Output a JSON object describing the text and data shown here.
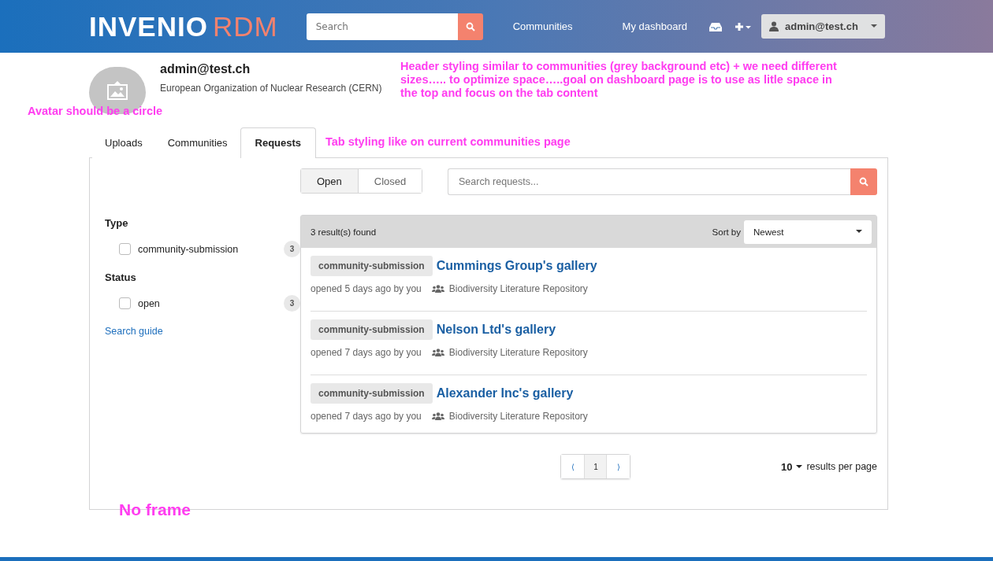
{
  "header": {
    "logo": {
      "word": "INVENIO",
      "accent": "RDM"
    },
    "search": {
      "placeholder": "Search"
    },
    "nav": [
      "Communities"
    ],
    "dashboard": "My dashboard",
    "user": "admin@test.ch"
  },
  "profile": {
    "name": "admin@test.ch",
    "affiliation": "European Organization of Nuclear Research (CERN)"
  },
  "tabs": [
    {
      "label": "Uploads",
      "selected": false
    },
    {
      "label": "Communities",
      "selected": false
    },
    {
      "label": "Requests",
      "selected": true
    }
  ],
  "status_toggle": [
    {
      "label": "Open",
      "selected": true
    },
    {
      "label": "Closed",
      "selected": false
    }
  ],
  "request_search": {
    "placeholder": "Search requests..."
  },
  "facets": [
    {
      "title": "Type",
      "options": [
        {
          "label": "community-submission",
          "count": "3",
          "checked": false
        }
      ]
    },
    {
      "title": "Status",
      "options": [
        {
          "label": "open",
          "count": "3",
          "checked": false
        }
      ]
    }
  ],
  "search_guide": "Search guide",
  "results": {
    "summary": "3 result(s) found",
    "sort_label": "Sort by",
    "sort_value": "Newest",
    "items": [
      {
        "type": "community-submission",
        "title": "Cummings Group's gallery",
        "meta": "opened 5 days ago by you",
        "community": "Biodiversity Literature Repository"
      },
      {
        "type": "community-submission",
        "title": "Nelson Ltd's gallery",
        "meta": "opened 7 days ago by you",
        "community": "Biodiversity Literature Repository"
      },
      {
        "type": "community-submission",
        "title": "Alexander Inc's gallery",
        "meta": "opened 7 days ago by you",
        "community": "Biodiversity Literature Repository"
      }
    ]
  },
  "pagination": {
    "prev": "⟨",
    "pages": [
      {
        "label": "1",
        "selected": true
      }
    ],
    "next": "⟩"
  },
  "per_page": {
    "value": "10",
    "label": "results per page"
  },
  "annotations": [
    {
      "kind": "header",
      "text": "Header styling similar to communities (grey background etc) + we need different sizes….. to optimize space…..goal on dashboard page is to use as litle space in the top and focus on the tab content"
    },
    {
      "kind": "avatar",
      "text": "Avatar should be a circle"
    },
    {
      "kind": "tabs",
      "text": "Tab styling like on current communities page"
    },
    {
      "kind": "frame",
      "text": "No frame"
    }
  ]
}
